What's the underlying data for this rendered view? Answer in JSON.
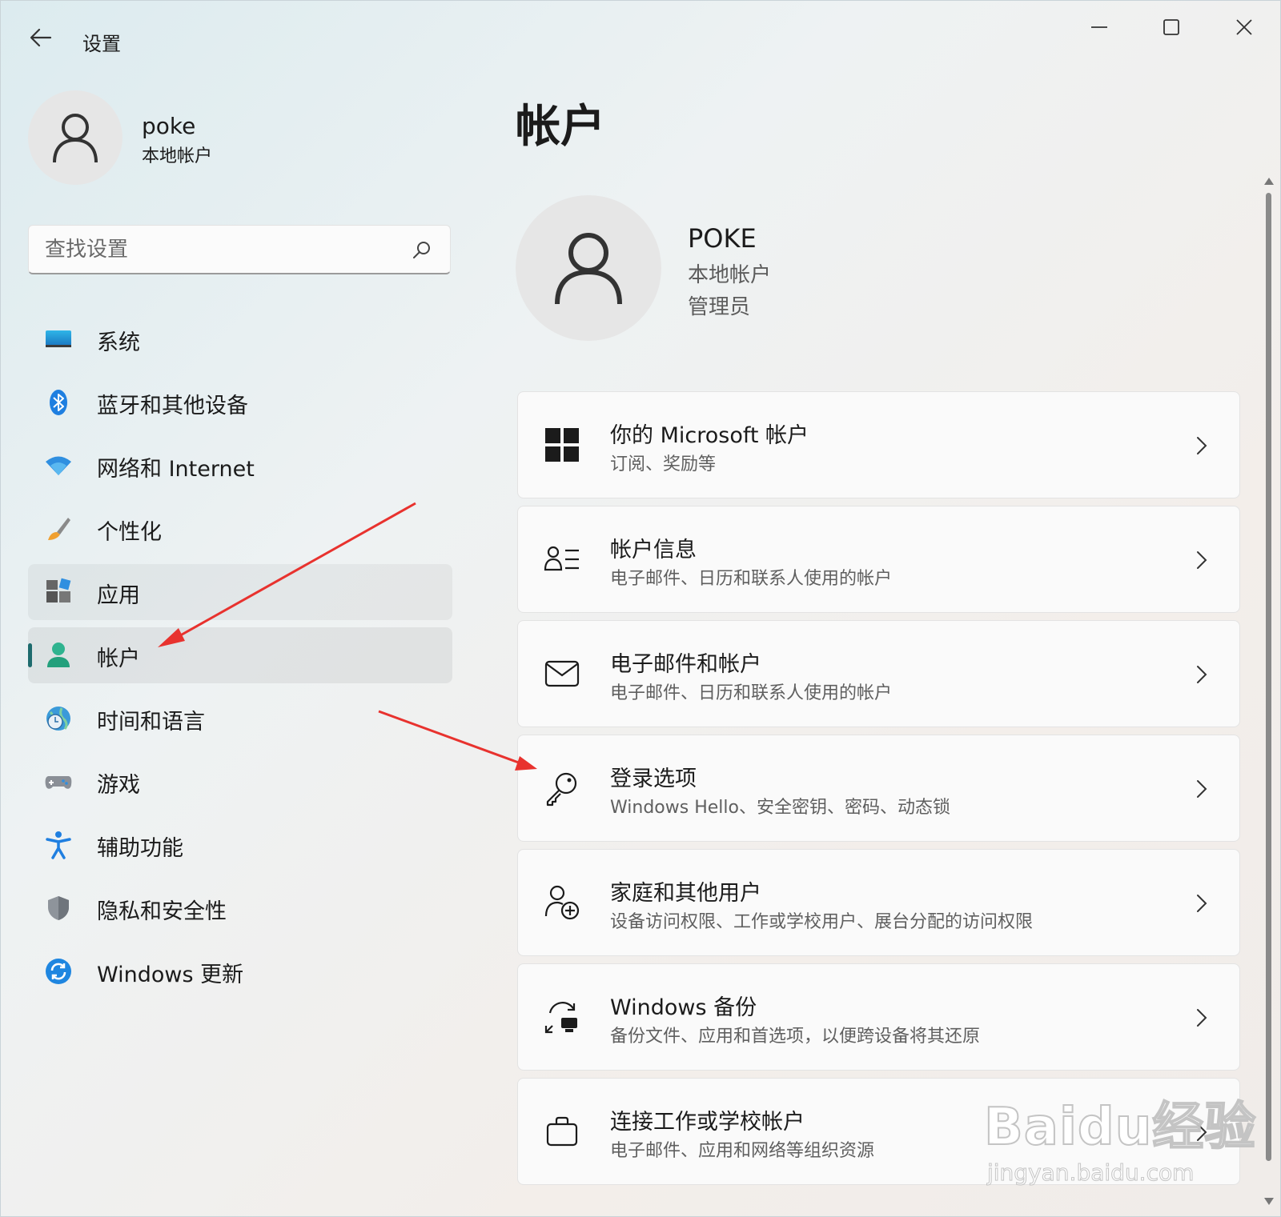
{
  "window": {
    "title": "设置",
    "controls": [
      "minimize",
      "maximize",
      "close"
    ]
  },
  "sidebar": {
    "user": {
      "name": "poke",
      "type": "本地帐户"
    },
    "search": {
      "placeholder": "查找设置",
      "value": ""
    },
    "items": [
      {
        "label": "系统",
        "icon": "system-icon"
      },
      {
        "label": "蓝牙和其他设备",
        "icon": "bluetooth-icon"
      },
      {
        "label": "网络和 Internet",
        "icon": "wifi-icon"
      },
      {
        "label": "个性化",
        "icon": "brush-icon"
      },
      {
        "label": "应用",
        "icon": "apps-icon"
      },
      {
        "label": "帐户",
        "icon": "account-icon",
        "selected": true
      },
      {
        "label": "时间和语言",
        "icon": "time-language-icon"
      },
      {
        "label": "游戏",
        "icon": "gamepad-icon"
      },
      {
        "label": "辅助功能",
        "icon": "accessibility-icon"
      },
      {
        "label": "隐私和安全性",
        "icon": "shield-icon"
      },
      {
        "label": "Windows 更新",
        "icon": "update-icon"
      }
    ]
  },
  "main": {
    "title": "帐户",
    "account": {
      "name": "POKE",
      "type": "本地帐户",
      "role": "管理员"
    },
    "cards": [
      {
        "title": "你的 Microsoft 帐户",
        "subtitle": "订阅、奖励等",
        "icon": "windows-logo-icon"
      },
      {
        "title": "帐户信息",
        "subtitle": "电子邮件、日历和联系人使用的帐户",
        "icon": "account-info-icon"
      },
      {
        "title": "电子邮件和帐户",
        "subtitle": "电子邮件、日历和联系人使用的帐户",
        "icon": "mail-icon"
      },
      {
        "title": "登录选项",
        "subtitle": "Windows Hello、安全密钥、密码、动态锁",
        "icon": "key-icon"
      },
      {
        "title": "家庭和其他用户",
        "subtitle": "设备访问权限、工作或学校用户、展台分配的访问权限",
        "icon": "add-user-icon"
      },
      {
        "title": "Windows 备份",
        "subtitle": "备份文件、应用和首选项，以便跨设备将其还原",
        "icon": "backup-icon"
      },
      {
        "title": "连接工作或学校帐户",
        "subtitle": "电子邮件、应用和网络等组织资源",
        "icon": "briefcase-icon"
      }
    ]
  },
  "watermark": {
    "logo": "Baidu经验",
    "url": "jingyan.baidu.com"
  },
  "colors": {
    "accent": "#1e6b6e",
    "annotation_arrow": "#e8322e"
  }
}
